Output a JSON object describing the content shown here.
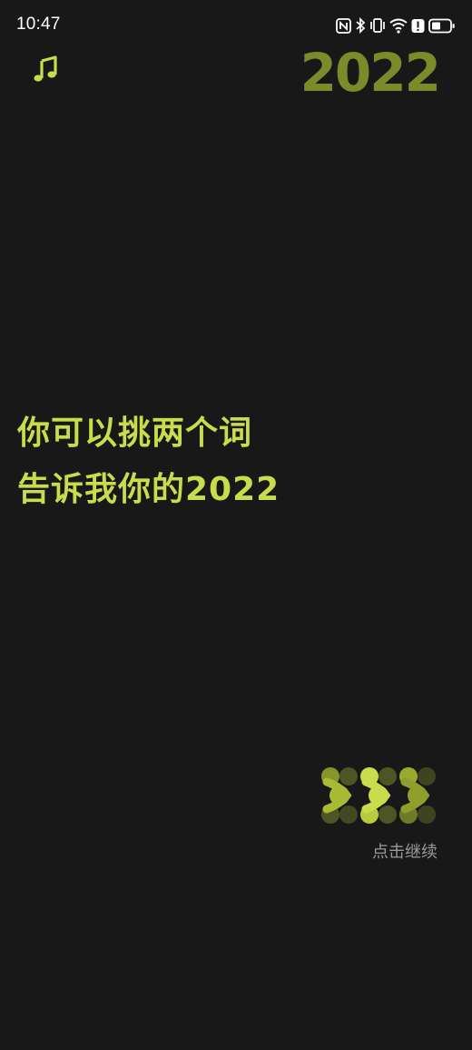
{
  "status_bar": {
    "time": "10:47",
    "icons": [
      "nfc-icon",
      "bluetooth-icon",
      "vibrate-icon",
      "wifi-icon",
      "alert-icon",
      "battery-icon"
    ]
  },
  "header": {
    "music_icon": "music-note-icon",
    "year_logo": "2022"
  },
  "prompt": {
    "line1": "你可以挑两个词",
    "line2": "告诉我你的2022"
  },
  "continue": {
    "icon": "triple-chevron-icon",
    "label": "点击继续"
  },
  "colors": {
    "background": "#181818",
    "accent": "#c8dc4c",
    "logo": "#7d8a2a",
    "muted_text": "#9a9a9a"
  }
}
